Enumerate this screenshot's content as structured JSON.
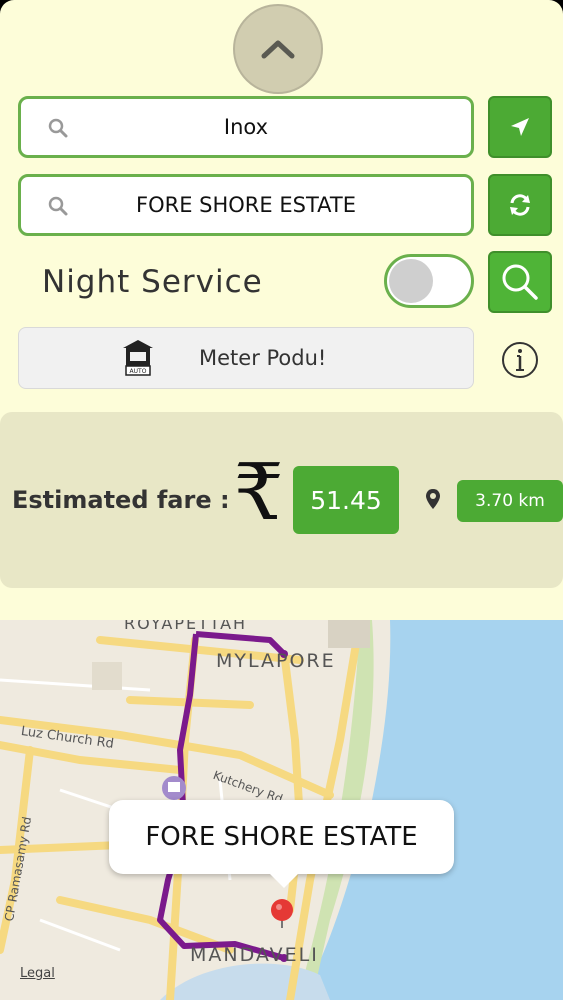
{
  "route": {
    "from_value": "Inox",
    "to_value": "FORE SHORE ESTATE"
  },
  "night_service": {
    "label": "Night Service",
    "enabled": false
  },
  "meter": {
    "label": "Meter Podu!",
    "icon_text": "AUTO"
  },
  "fare": {
    "label": "Estimated fare :",
    "currency_symbol": "₹",
    "value": "51.45",
    "distance": "3.70 km"
  },
  "map": {
    "labels": {
      "royapettah": "ROYAPETTAH",
      "mylapore": "MYLAPORE",
      "luz_church": "Luz Church Rd",
      "kutchery": "Kutchery Rd",
      "cp_ramasamy": "CP Ramasamy Rd",
      "mandaveli": "MANDAVELI"
    },
    "callout": "FORE SHORE ESTATE",
    "legal": "Legal"
  },
  "colors": {
    "accent_green": "#4caa34",
    "panel_bg": "#fdfdd9",
    "route_purple": "#7b1a8c",
    "sea_blue": "#a7d3ef"
  },
  "icons": {
    "collapse": "chevron-up-icon",
    "search": "search-icon",
    "locate": "location-arrow-icon",
    "swap": "refresh-icon",
    "info": "info-icon",
    "pin": "map-pin-icon"
  }
}
